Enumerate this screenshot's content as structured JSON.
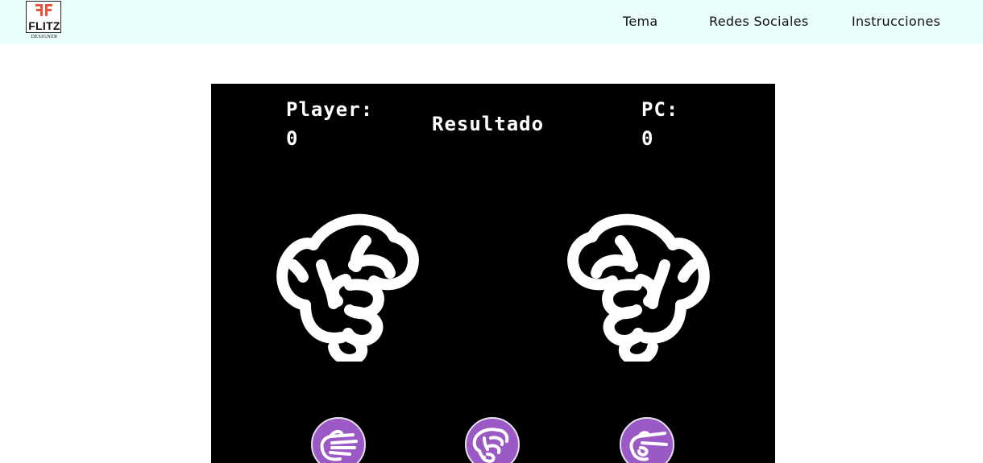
{
  "header": {
    "logo": {
      "mark": "FF",
      "word": "FLITZ",
      "sub": "DESIGNER"
    },
    "nav": [
      {
        "label": "Tema"
      },
      {
        "label": "Redes Sociales"
      },
      {
        "label": "Instrucciones"
      }
    ]
  },
  "game": {
    "player_label": "Player:",
    "player_score": "0",
    "result_label": "Resultado",
    "pc_label": "PC:",
    "pc_score": "0",
    "choices": [
      {
        "name": "paper",
        "icon": "open-hand-icon"
      },
      {
        "name": "rock",
        "icon": "fist-icon"
      },
      {
        "name": "scissors",
        "icon": "scissors-hand-icon"
      }
    ],
    "colors": {
      "background": "#000000",
      "foreground": "#ffffff",
      "choice_button": "#9b59c6"
    }
  }
}
